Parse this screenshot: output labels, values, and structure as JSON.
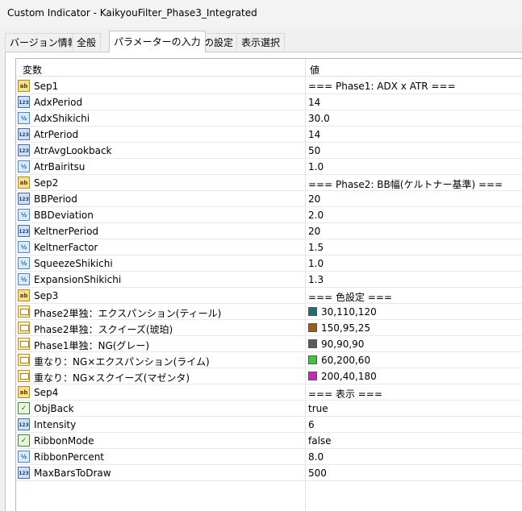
{
  "window": {
    "title": "Custom Indicator - KaikyouFilter_Phase3_Integrated"
  },
  "tabs": [
    {
      "label": "バージョン情報"
    },
    {
      "label": "全般"
    },
    {
      "label": "パラメーターの入力"
    },
    {
      "label": "色の設定"
    },
    {
      "label": "表示選択"
    }
  ],
  "active_tab": "パラメーターの入力",
  "grid": {
    "headers": {
      "variable": "変数",
      "value": "値"
    },
    "rows": [
      {
        "icon": "string-icon",
        "name": "Sep1",
        "value": "=== Phase1: ADX x ATR ==="
      },
      {
        "icon": "integer-icon",
        "name": "AdxPeriod",
        "value": "14"
      },
      {
        "icon": "double-icon",
        "name": "AdxShikichi",
        "value": "30.0"
      },
      {
        "icon": "integer-icon",
        "name": "AtrPeriod",
        "value": "14"
      },
      {
        "icon": "integer-icon",
        "name": "AtrAvgLookback",
        "value": "50"
      },
      {
        "icon": "double-icon",
        "name": "AtrBairitsu",
        "value": "1.0"
      },
      {
        "icon": "string-icon",
        "name": "Sep2",
        "value": "=== Phase2: BB幅(ケルトナー基準) ==="
      },
      {
        "icon": "integer-icon",
        "name": "BBPeriod",
        "value": "20"
      },
      {
        "icon": "double-icon",
        "name": "BBDeviation",
        "value": "2.0"
      },
      {
        "icon": "integer-icon",
        "name": "KeltnerPeriod",
        "value": "20"
      },
      {
        "icon": "double-icon",
        "name": "KeltnerFactor",
        "value": "1.5"
      },
      {
        "icon": "double-icon",
        "name": "SqueezeShikichi",
        "value": "1.0"
      },
      {
        "icon": "double-icon",
        "name": "ExpansionShikichi",
        "value": "1.3"
      },
      {
        "icon": "string-icon",
        "name": "Sep3",
        "value": "=== 色設定 ==="
      },
      {
        "icon": "color-icon",
        "name": "Phase2単独：エクスパンション(ティール)",
        "value": "30,110,120",
        "swatch": "#1e6e78"
      },
      {
        "icon": "color-icon",
        "name": "Phase2単独：スクイーズ(琥珀)",
        "value": "150,95,25",
        "swatch": "#965f19"
      },
      {
        "icon": "color-icon",
        "name": "Phase1単独：NG(グレー)",
        "value": "90,90,90",
        "swatch": "#5a5a5a"
      },
      {
        "icon": "color-icon",
        "name": "重なり：NG×エクスパンション(ライム)",
        "value": "60,200,60",
        "swatch": "#3cc83c"
      },
      {
        "icon": "color-icon",
        "name": "重なり：NG×スクイーズ(マゼンタ)",
        "value": "200,40,180",
        "swatch": "#c828b4"
      },
      {
        "icon": "string-icon",
        "name": "Sep4",
        "value": "=== 表示 ==="
      },
      {
        "icon": "bool-icon",
        "name": "ObjBack",
        "value": "true"
      },
      {
        "icon": "integer-icon",
        "name": "Intensity",
        "value": "6"
      },
      {
        "icon": "bool-icon",
        "name": "RibbonMode",
        "value": "false"
      },
      {
        "icon": "double-icon",
        "name": "RibbonPercent",
        "value": "8.0"
      },
      {
        "icon": "integer-icon",
        "name": "MaxBarsToDraw",
        "value": "500"
      }
    ]
  }
}
